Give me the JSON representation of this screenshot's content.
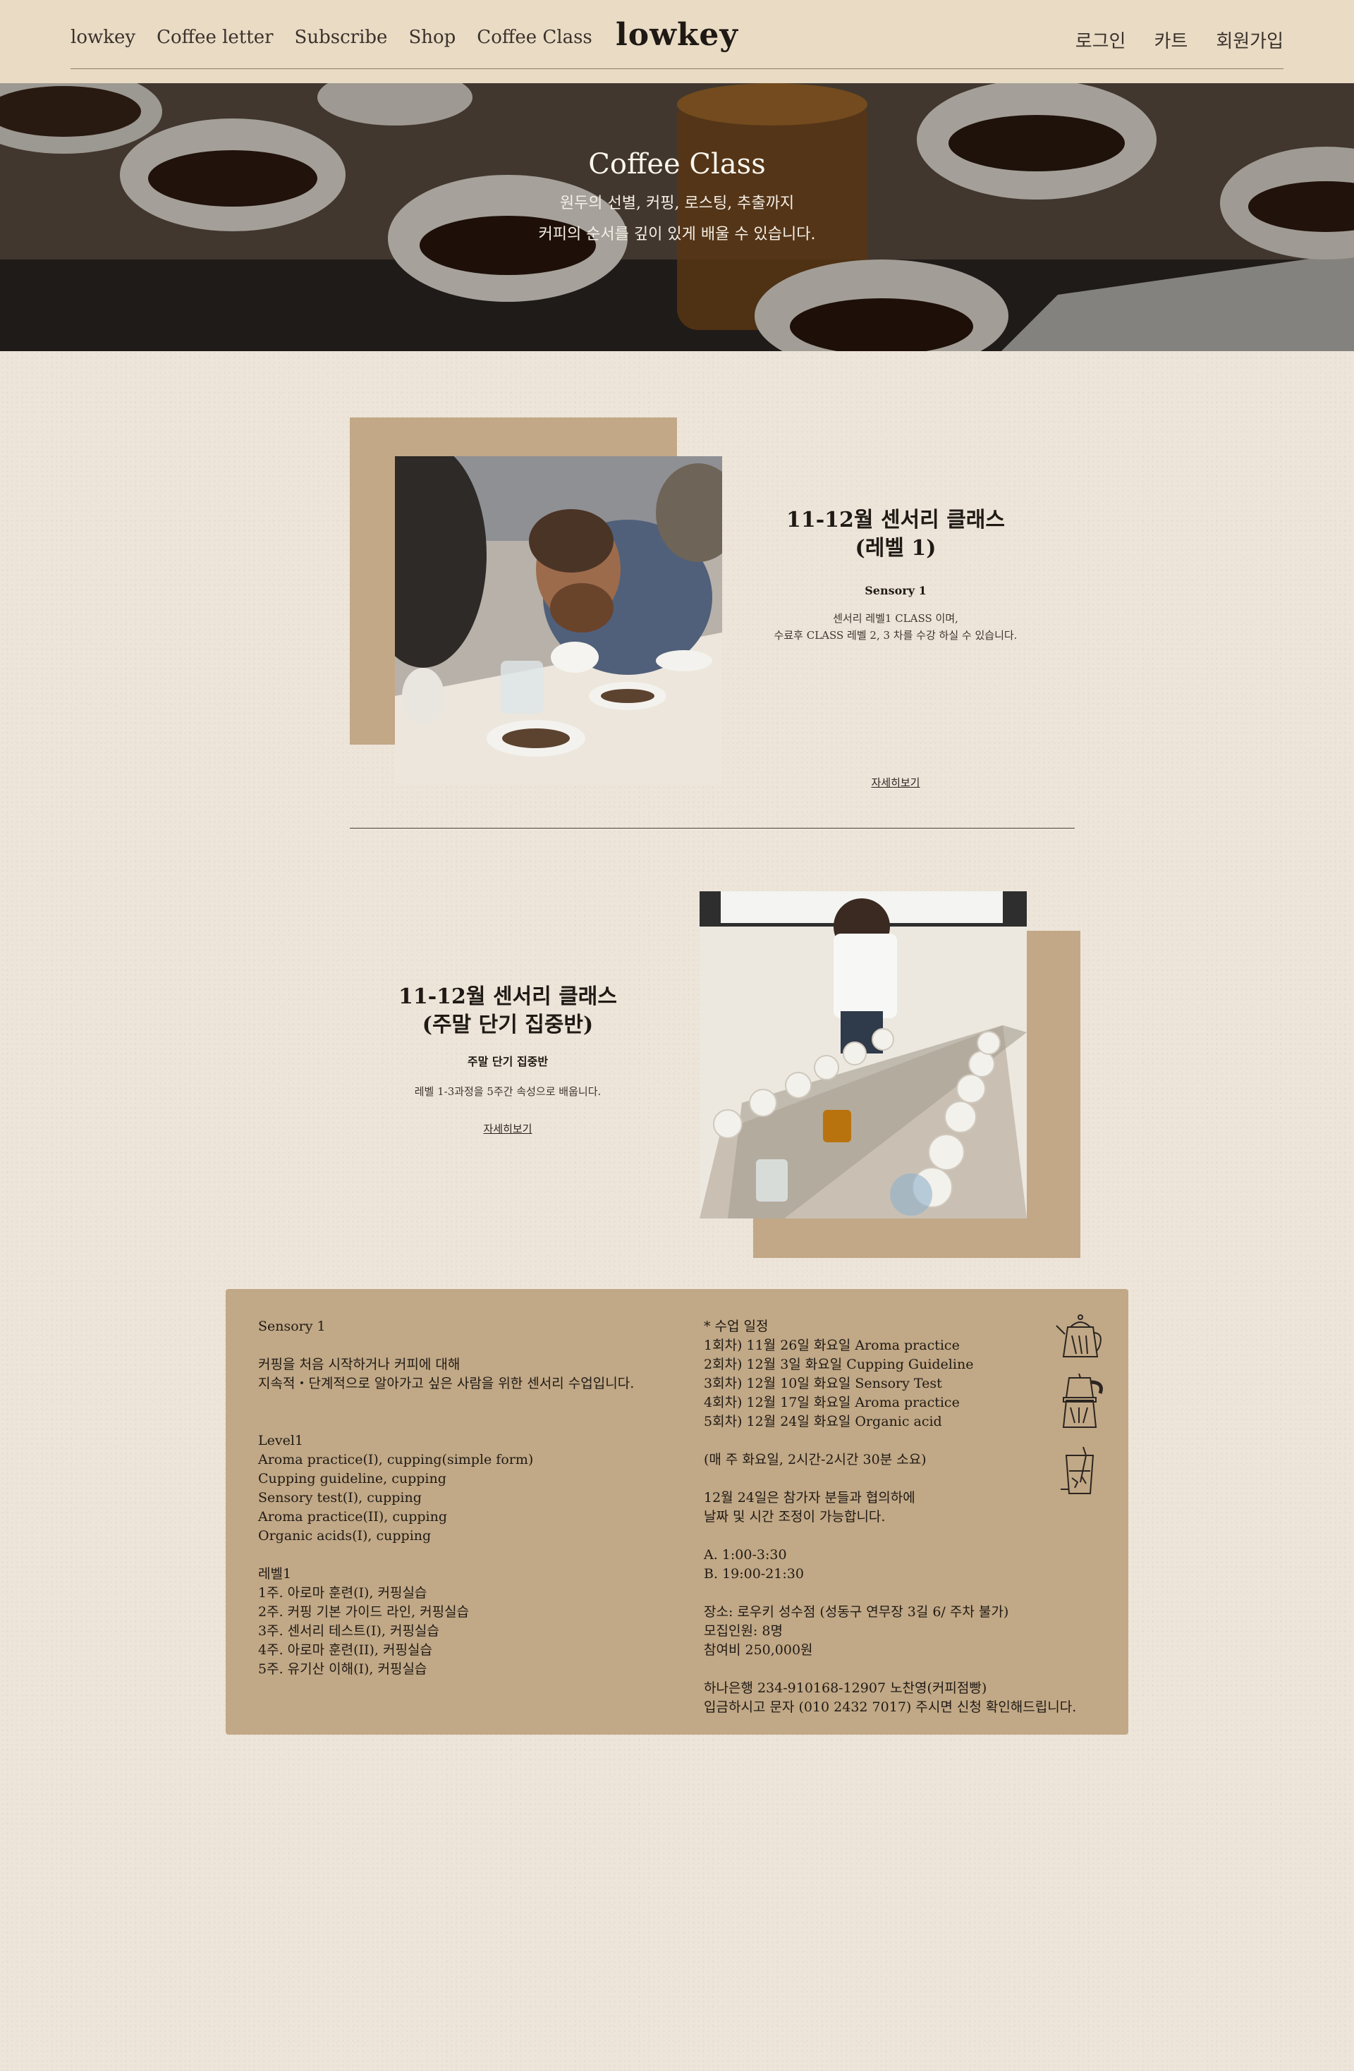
{
  "header": {
    "logo": "lowkey",
    "nav_left": [
      "lowkey",
      "Coffee letter",
      "Subscribe",
      "Shop",
      "Coffee Class"
    ],
    "nav_right": [
      "로그인",
      "카트",
      "회원가입"
    ]
  },
  "hero": {
    "title": "Coffee Class",
    "line1": "원두의 선별, 커핑, 로스팅, 추출까지",
    "line2": "커피의 순서를 깊이 있게 배울 수 있습니다."
  },
  "class1": {
    "title_line1": "11-12월 센서리 클래스",
    "title_line2": "(레벨 1)",
    "subtitle": "Sensory 1",
    "desc_line1": "센서리 레벨1 CLASS 이며,",
    "desc_line2": "수료후 CLASS 레벨 2, 3 차를 수강 하실 수 있습니다.",
    "link": "자세히보기"
  },
  "class2": {
    "title_line1": "11-12월 센서리 클래스",
    "title_line2": "(주말 단기 집중반)",
    "subtitle": "주말 단기 집중반",
    "desc": "레벨 1-3과정을 5주간 속성으로 배웁니다.",
    "link": "자세히보기"
  },
  "info": {
    "left": {
      "title": "Sensory 1",
      "intro1": "커핑을 처음 시작하거나 커피에 대해",
      "intro2": "지속적・단계적으로 알아가고 싶은 사람을 위한 센서리 수업입니다.",
      "en_header": "Level1",
      "en_items": [
        "Aroma practice(I), cupping(simple form)",
        "Cupping guideline, cupping",
        "Sensory test(I), cupping",
        "Aroma practice(II), cupping",
        "Organic acids(I), cupping"
      ],
      "ko_header": "레벨1",
      "ko_items": [
        "1주. 아로마 훈련(I), 커핑실습",
        "2주. 커핑 기본 가이드 라인, 커핑실습",
        "3주. 센서리 테스트(I), 커핑실습",
        "4주. 아로마 훈련(II), 커핑실습",
        "5주. 유기산 이해(I), 커핑실습"
      ]
    },
    "right": {
      "schedule_header": "* 수업 일정",
      "schedule": [
        "1회차) 11월 26일 화요일 Aroma practice",
        "2회차) 12월 3일 화요일 Cupping Guideline",
        "3회차) 12월 10일 화요일 Sensory Test",
        "4회차) 12월 17일 화요일 Aroma practice",
        "5회차)  12월 24일 화요일 Organic acid"
      ],
      "duration": "(매 주 화요일, 2시간-2시간 30분 소요)",
      "note1": "12월 24일은 참가자 분들과 협의하에",
      "note2": "날짜 및 시간 조정이 가능합니다.",
      "time_a": "A. 1:00-3:30",
      "time_b": "B.   19:00-21:30",
      "place": "장소: 로우키 성수점 (성동구 연무장 3길 6/ 주차 불가)",
      "capacity": "모집인원: 8명",
      "fee": "참여비 250,000원",
      "bank": "하나은행 234-910168-12907 노찬영(커피점빵)",
      "contact": "입금하시고 문자 (010 2432 7017) 주시면 신청 확인해드립니다."
    }
  },
  "icons": [
    "kettle-icon",
    "moka-pot-icon",
    "cold-brew-glass-icon"
  ],
  "colors": {
    "background": "#eee5da",
    "header": "#e9dbc4",
    "tan_block": "#c2a887",
    "info_box": "#c1a886",
    "text": "#2b2520"
  }
}
